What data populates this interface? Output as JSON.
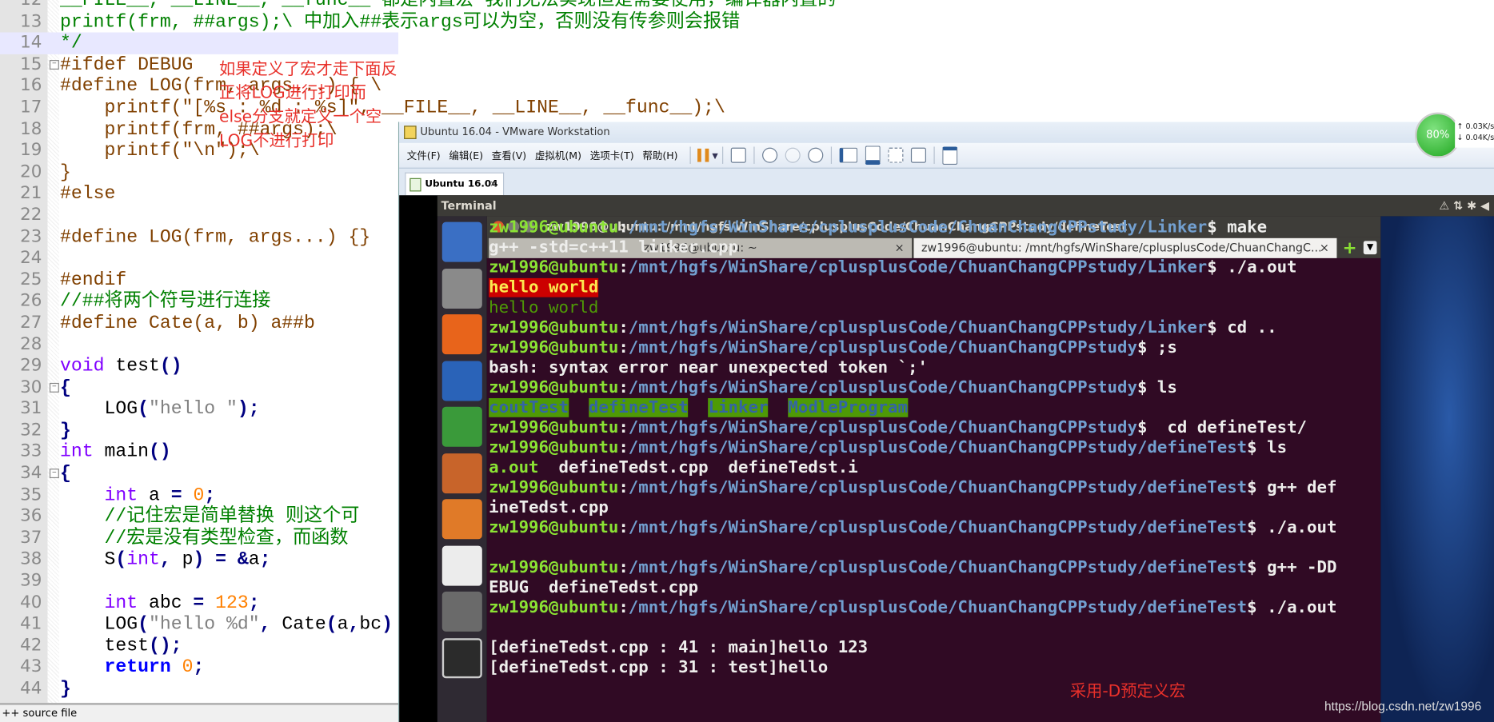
{
  "editor": {
    "first_line": 12,
    "highlight_line": 14,
    "lines": [
      [
        [
          "__FILE__, __LINE__, __func__ 都是内置宏 我们无法实现但是需要使用，编译器内置的",
          "cm"
        ]
      ],
      [
        [
          "printf(frm, ##args);\\ 中加入##表示args可以为空，否则没有传参则会报错",
          "cm"
        ]
      ],
      [
        [
          "*/",
          "cm"
        ]
      ],
      [
        [
          "#ifdef DEBUG",
          "pp"
        ]
      ],
      [
        [
          "#define LOG(frm, args...) { \\",
          "pp"
        ]
      ],
      [
        [
          "    printf(\"[%s : %d : %s]\", __FILE__, __LINE__, __func__);\\",
          "pp"
        ]
      ],
      [
        [
          "    printf(frm, ##args);\\",
          "pp"
        ]
      ],
      [
        [
          "    printf(\"\\n\");\\",
          "pp"
        ]
      ],
      [
        [
          "}",
          "pp"
        ]
      ],
      [
        [
          "#else",
          "pp"
        ]
      ],
      [],
      [
        [
          "#define LOG(frm, args...) {}",
          "pp"
        ]
      ],
      [],
      [
        [
          "#endif",
          "pp"
        ]
      ],
      [
        [
          "//##将两个符号进行连接",
          "cm"
        ]
      ],
      [
        [
          "#define Cate(a, b) a##b",
          "pp"
        ]
      ],
      [],
      [
        [
          "void",
          "kw"
        ],
        [
          " test",
          "tx"
        ],
        [
          "()",
          "op"
        ]
      ],
      [
        [
          "{",
          "op"
        ]
      ],
      [
        [
          "    LOG",
          "tx"
        ],
        [
          "(",
          "op"
        ],
        [
          "\"hello \"",
          "st"
        ],
        [
          ");",
          "op"
        ]
      ],
      [
        [
          "}",
          "op"
        ]
      ],
      [
        [
          "int",
          "kw"
        ],
        [
          " main",
          "tx"
        ],
        [
          "()",
          "op"
        ]
      ],
      [
        [
          "{",
          "op"
        ]
      ],
      [
        [
          "    ",
          "tx"
        ],
        [
          "int",
          "kw"
        ],
        [
          " a ",
          "tx"
        ],
        [
          "=",
          "op"
        ],
        [
          " ",
          "tx"
        ],
        [
          "0",
          "nm"
        ],
        [
          ";",
          "op"
        ]
      ],
      [
        [
          "    //记住宏是简单替换 则这个可",
          "cm"
        ]
      ],
      [
        [
          "    //宏是没有类型检查，而函数",
          "cm"
        ]
      ],
      [
        [
          "    S",
          "tx"
        ],
        [
          "(",
          "op"
        ],
        [
          "int",
          "kw"
        ],
        [
          ",",
          "op"
        ],
        [
          " p",
          "tx"
        ],
        [
          ")",
          "op"
        ],
        [
          " ",
          "tx"
        ],
        [
          "=",
          "op"
        ],
        [
          " ",
          "tx"
        ],
        [
          "&",
          "op"
        ],
        [
          "a",
          "tx"
        ],
        [
          ";",
          "op"
        ]
      ],
      [],
      [
        [
          "    ",
          "tx"
        ],
        [
          "int",
          "kw"
        ],
        [
          " abc ",
          "tx"
        ],
        [
          "=",
          "op"
        ],
        [
          " ",
          "tx"
        ],
        [
          "123",
          "nm"
        ],
        [
          ";",
          "op"
        ]
      ],
      [
        [
          "    LOG",
          "tx"
        ],
        [
          "(",
          "op"
        ],
        [
          "\"hello %d\"",
          "st"
        ],
        [
          ",",
          "op"
        ],
        [
          " Cate",
          "tx"
        ],
        [
          "(",
          "op"
        ],
        [
          "a",
          "tx"
        ],
        [
          ",",
          "op"
        ],
        [
          "bc",
          "tx"
        ],
        [
          ")",
          "op"
        ]
      ],
      [
        [
          "    test",
          "tx"
        ],
        [
          "();",
          "op"
        ]
      ],
      [
        [
          "    ",
          "tx"
        ],
        [
          "return",
          "rk"
        ],
        [
          " ",
          "tx"
        ],
        [
          "0",
          "nm"
        ],
        [
          ";",
          "op"
        ]
      ],
      [
        [
          "}",
          "op"
        ]
      ]
    ],
    "annotation": "如果定义了宏才走下面反正将LOG进行打印而else分支就定义一个空LOG不进行打印",
    "status": "++ source file"
  },
  "vmware": {
    "title": "Ubuntu 16.04 - VMware Workstation",
    "menu": [
      "文件(F)",
      "编辑(E)",
      "查看(V)",
      "虚拟机(M)",
      "选项卡(T)",
      "帮助(H)"
    ],
    "tab": "Ubuntu 16.04",
    "tab_close": "×"
  },
  "ubuntu": {
    "topbar_title": "Terminal",
    "topbar_icons": "⚠ ⇅ ✱ ◀",
    "launcher": [
      "ubuntu-dash",
      "files",
      "firefox",
      "writer",
      "calc",
      "impress",
      "software-center",
      "amazon",
      "system-settings",
      "terminal"
    ]
  },
  "terminal": {
    "title": "zw1996@ubuntu: /mnt/hgfs/WinShare/cplusplusCode/ChuanChangCPPstudy/defineTest",
    "tabs": [
      {
        "label": "zw1996@ubuntu: ~",
        "active": false
      },
      {
        "label": "zw1996@ubuntu: /mnt/hgfs/WinShare/cplusplusCode/ChuanChangC...",
        "active": true
      }
    ],
    "tab_close": "×",
    "lines": [
      [
        [
          "zw1996@ubuntu",
          "u"
        ],
        [
          ":",
          "w"
        ],
        [
          "/mnt/hgfs/WinShare/cplusplusCode/ChuanChangCPPstudy/Linker",
          "p"
        ],
        [
          "$ make",
          "w"
        ]
      ],
      [
        [
          "g++ -std=c++11 linker.cpp",
          "w"
        ]
      ],
      [
        [
          "zw1996@ubuntu",
          "u"
        ],
        [
          ":",
          "w"
        ],
        [
          "/mnt/hgfs/WinShare/cplusplusCode/ChuanChangCPPstudy/Linker",
          "p"
        ],
        [
          "$ ./a.out",
          "w"
        ]
      ],
      [
        [
          "hello world",
          "red"
        ]
      ],
      [
        [
          "hello world",
          "dg"
        ]
      ],
      [
        [
          "zw1996@ubuntu",
          "u"
        ],
        [
          ":",
          "w"
        ],
        [
          "/mnt/hgfs/WinShare/cplusplusCode/ChuanChangCPPstudy/Linker",
          "p"
        ],
        [
          "$ cd ..",
          "w"
        ]
      ],
      [
        [
          "zw1996@ubuntu",
          "u"
        ],
        [
          ":",
          "w"
        ],
        [
          "/mnt/hgfs/WinShare/cplusplusCode/ChuanChangCPPstudy",
          "p"
        ],
        [
          "$ ;s",
          "w"
        ]
      ],
      [
        [
          "bash: syntax error near unexpected token `;'",
          "w"
        ]
      ],
      [
        [
          "zw1996@ubuntu",
          "u"
        ],
        [
          ":",
          "w"
        ],
        [
          "/mnt/hgfs/WinShare/cplusplusCode/ChuanChangCPPstudy",
          "p"
        ],
        [
          "$ ls",
          "w"
        ]
      ],
      [
        [
          "coutTest",
          "gbg"
        ],
        [
          "  ",
          "w"
        ],
        [
          "defineTest",
          "gbg"
        ],
        [
          "  ",
          "w"
        ],
        [
          "Linker",
          "gbg"
        ],
        [
          "  ",
          "w"
        ],
        [
          "ModleProgram",
          "gbg"
        ]
      ],
      [
        [
          "zw1996@ubuntu",
          "u"
        ],
        [
          ":",
          "w"
        ],
        [
          "/mnt/hgfs/WinShare/cplusplusCode/ChuanChangCPPstudy",
          "p"
        ],
        [
          "$  cd defineTest/",
          "w"
        ]
      ],
      [
        [
          "zw1996@ubuntu",
          "u"
        ],
        [
          ":",
          "w"
        ],
        [
          "/mnt/hgfs/WinShare/cplusplusCode/ChuanChangCPPstudy/defineTest",
          "p"
        ],
        [
          "$ ls",
          "w"
        ]
      ],
      [
        [
          "a.out",
          "gx"
        ],
        [
          "  defineTedst.cpp  defineTedst.i",
          "w"
        ]
      ],
      [
        [
          "zw1996@ubuntu",
          "u"
        ],
        [
          ":",
          "w"
        ],
        [
          "/mnt/hgfs/WinShare/cplusplusCode/ChuanChangCPPstudy/defineTest",
          "p"
        ],
        [
          "$ g++ def",
          "w"
        ]
      ],
      [
        [
          "ineTedst.cpp",
          "w"
        ]
      ],
      [
        [
          "zw1996@ubuntu",
          "u"
        ],
        [
          ":",
          "w"
        ],
        [
          "/mnt/hgfs/WinShare/cplusplusCode/ChuanChangCPPstudy/defineTest",
          "p"
        ],
        [
          "$ ./a.out",
          "w"
        ]
      ],
      [],
      [
        [
          "zw1996@ubuntu",
          "u"
        ],
        [
          ":",
          "w"
        ],
        [
          "/mnt/hgfs/WinShare/cplusplusCode/ChuanChangCPPstudy/defineTest",
          "p"
        ],
        [
          "$ g++ -DD",
          "w"
        ]
      ],
      [
        [
          "EBUG  defineTedst.cpp",
          "w"
        ]
      ],
      [
        [
          "zw1996@ubuntu",
          "u"
        ],
        [
          ":",
          "w"
        ],
        [
          "/mnt/hgfs/WinShare/cplusplusCode/ChuanChangCPPstudy/defineTest",
          "p"
        ],
        [
          "$ ./a.out",
          "w"
        ]
      ],
      [],
      [
        [
          "[defineTedst.cpp : 41 : main]hello 123",
          "w"
        ]
      ],
      [
        [
          "[defineTedst.cpp : 31 : test]hello",
          "w"
        ]
      ]
    ],
    "annotation": "采用-D预定义宏"
  },
  "net_monitor": {
    "percent": "80%",
    "up": "↑ 0.03K/s",
    "down": "↓ 0.04K/s"
  },
  "watermark": "https://blog.csdn.net/zw1996",
  "colors": {
    "terminal_bg": "#300a24",
    "prompt_user": "#8ae234",
    "prompt_path": "#729fcf",
    "annotation": "#e8302a"
  }
}
